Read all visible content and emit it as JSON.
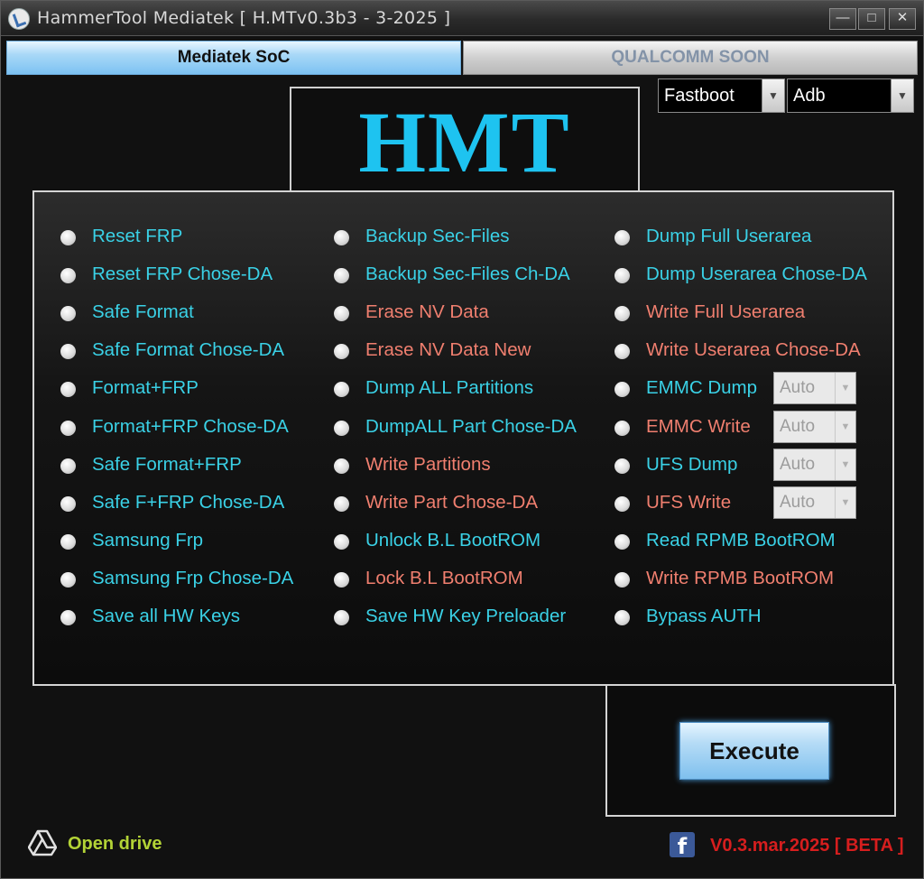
{
  "window": {
    "title": "HammerTool Mediatek [ H.MTv0.3b3 - 3-2025 ]",
    "controls": [
      "minimize",
      "maximize",
      "close"
    ]
  },
  "tabs": [
    {
      "label": "Mediatek SoC",
      "active": true
    },
    {
      "label": "QUALCOMM SOON",
      "active": false
    }
  ],
  "logo": {
    "text": "HMT"
  },
  "mode_selects": [
    {
      "value": "Fastboot"
    },
    {
      "value": "Adb"
    }
  ],
  "options": {
    "column1": [
      {
        "label": "Reset FRP",
        "color": "cyan"
      },
      {
        "label": "Reset FRP Chose-DA",
        "color": "cyan"
      },
      {
        "label": "Safe Format",
        "color": "cyan"
      },
      {
        "label": "Safe Format Chose-DA",
        "color": "cyan"
      },
      {
        "label": "Format+FRP",
        "color": "cyan"
      },
      {
        "label": "Format+FRP Chose-DA",
        "color": "cyan"
      },
      {
        "label": "Safe Format+FRP",
        "color": "cyan"
      },
      {
        "label": "Safe F+FRP Chose-DA",
        "color": "cyan"
      },
      {
        "label": "Samsung Frp",
        "color": "cyan"
      },
      {
        "label": "Samsung Frp Chose-DA",
        "color": "cyan"
      },
      {
        "label": "Save all HW Keys",
        "color": "cyan"
      }
    ],
    "column2": [
      {
        "label": "Backup Sec-Files",
        "color": "cyan"
      },
      {
        "label": "Backup Sec-Files Ch-DA",
        "color": "cyan"
      },
      {
        "label": "Erase NV Data",
        "color": "salmon"
      },
      {
        "label": "Erase NV Data New",
        "color": "salmon"
      },
      {
        "label": "Dump ALL Partitions",
        "color": "cyan"
      },
      {
        "label": "DumpALL Part Chose-DA",
        "color": "cyan"
      },
      {
        "label": "Write Partitions",
        "color": "salmon"
      },
      {
        "label": "Write Part Chose-DA",
        "color": "salmon"
      },
      {
        "label": "Unlock B.L BootROM",
        "color": "cyan"
      },
      {
        "label": "Lock B.L BootROM",
        "color": "salmon"
      },
      {
        "label": "Save HW Key Preloader",
        "color": "cyan"
      }
    ],
    "column3": [
      {
        "label": "Dump Full Userarea",
        "color": "cyan"
      },
      {
        "label": "Dump Userarea Chose-DA",
        "color": "cyan"
      },
      {
        "label": "Write Full Userarea",
        "color": "salmon"
      },
      {
        "label": "Write Userarea Chose-DA",
        "color": "salmon"
      },
      {
        "label": "EMMC Dump",
        "color": "cyan",
        "select": "Auto"
      },
      {
        "label": "EMMC Write",
        "color": "salmon",
        "select": "Auto"
      },
      {
        "label": "UFS Dump",
        "color": "cyan",
        "select": "Auto"
      },
      {
        "label": "UFS Write",
        "color": "salmon",
        "select": "Auto"
      },
      {
        "label": "Read RPMB BootROM",
        "color": "cyan"
      },
      {
        "label": "Write RPMB BootROM",
        "color": "salmon"
      },
      {
        "label": "Bypass AUTH",
        "color": "cyan"
      }
    ]
  },
  "colors": {
    "cyan": "#3ad1e6",
    "salmon": "#f07f6f",
    "logo": "#1ec3f0",
    "version": "#d61e1e",
    "drive": "#b3d336"
  },
  "execute_label": "Execute",
  "footer": {
    "drive_icon": "google-drive-icon",
    "drive_label": "Open drive",
    "social_icon": "facebook-icon",
    "version": "V0.3.mar.2025 [ BETA ]"
  }
}
